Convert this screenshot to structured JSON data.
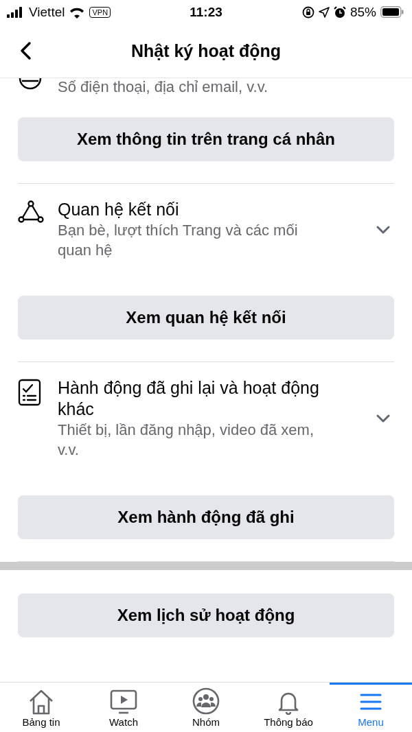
{
  "status_bar": {
    "carrier": "Viettel",
    "vpn": "VPN",
    "time": "11:23",
    "battery": "85%"
  },
  "header": {
    "title": "Nhật ký hoạt động"
  },
  "sections": [
    {
      "subtitle": "Số điện thoại, địa chỉ email, v.v.",
      "button": "Xem thông tin trên trang cá nhân"
    },
    {
      "title": "Quan hệ kết nối",
      "subtitle": "Bạn bè, lượt thích Trang và các mối quan hệ",
      "button": "Xem quan hệ kết nối"
    },
    {
      "title": "Hành động đã ghi lại và hoạt động khác",
      "subtitle": "Thiết bị, lần đăng nhập, video đã xem, v.v.",
      "button": "Xem hành động đã ghi"
    }
  ],
  "history_button": "Xem lịch sử hoạt động",
  "tabs": [
    {
      "label": "Bảng tin",
      "selected": false
    },
    {
      "label": "Watch",
      "selected": false
    },
    {
      "label": "Nhóm",
      "selected": false
    },
    {
      "label": "Thông báo",
      "selected": false
    },
    {
      "label": "Menu",
      "selected": true
    }
  ]
}
